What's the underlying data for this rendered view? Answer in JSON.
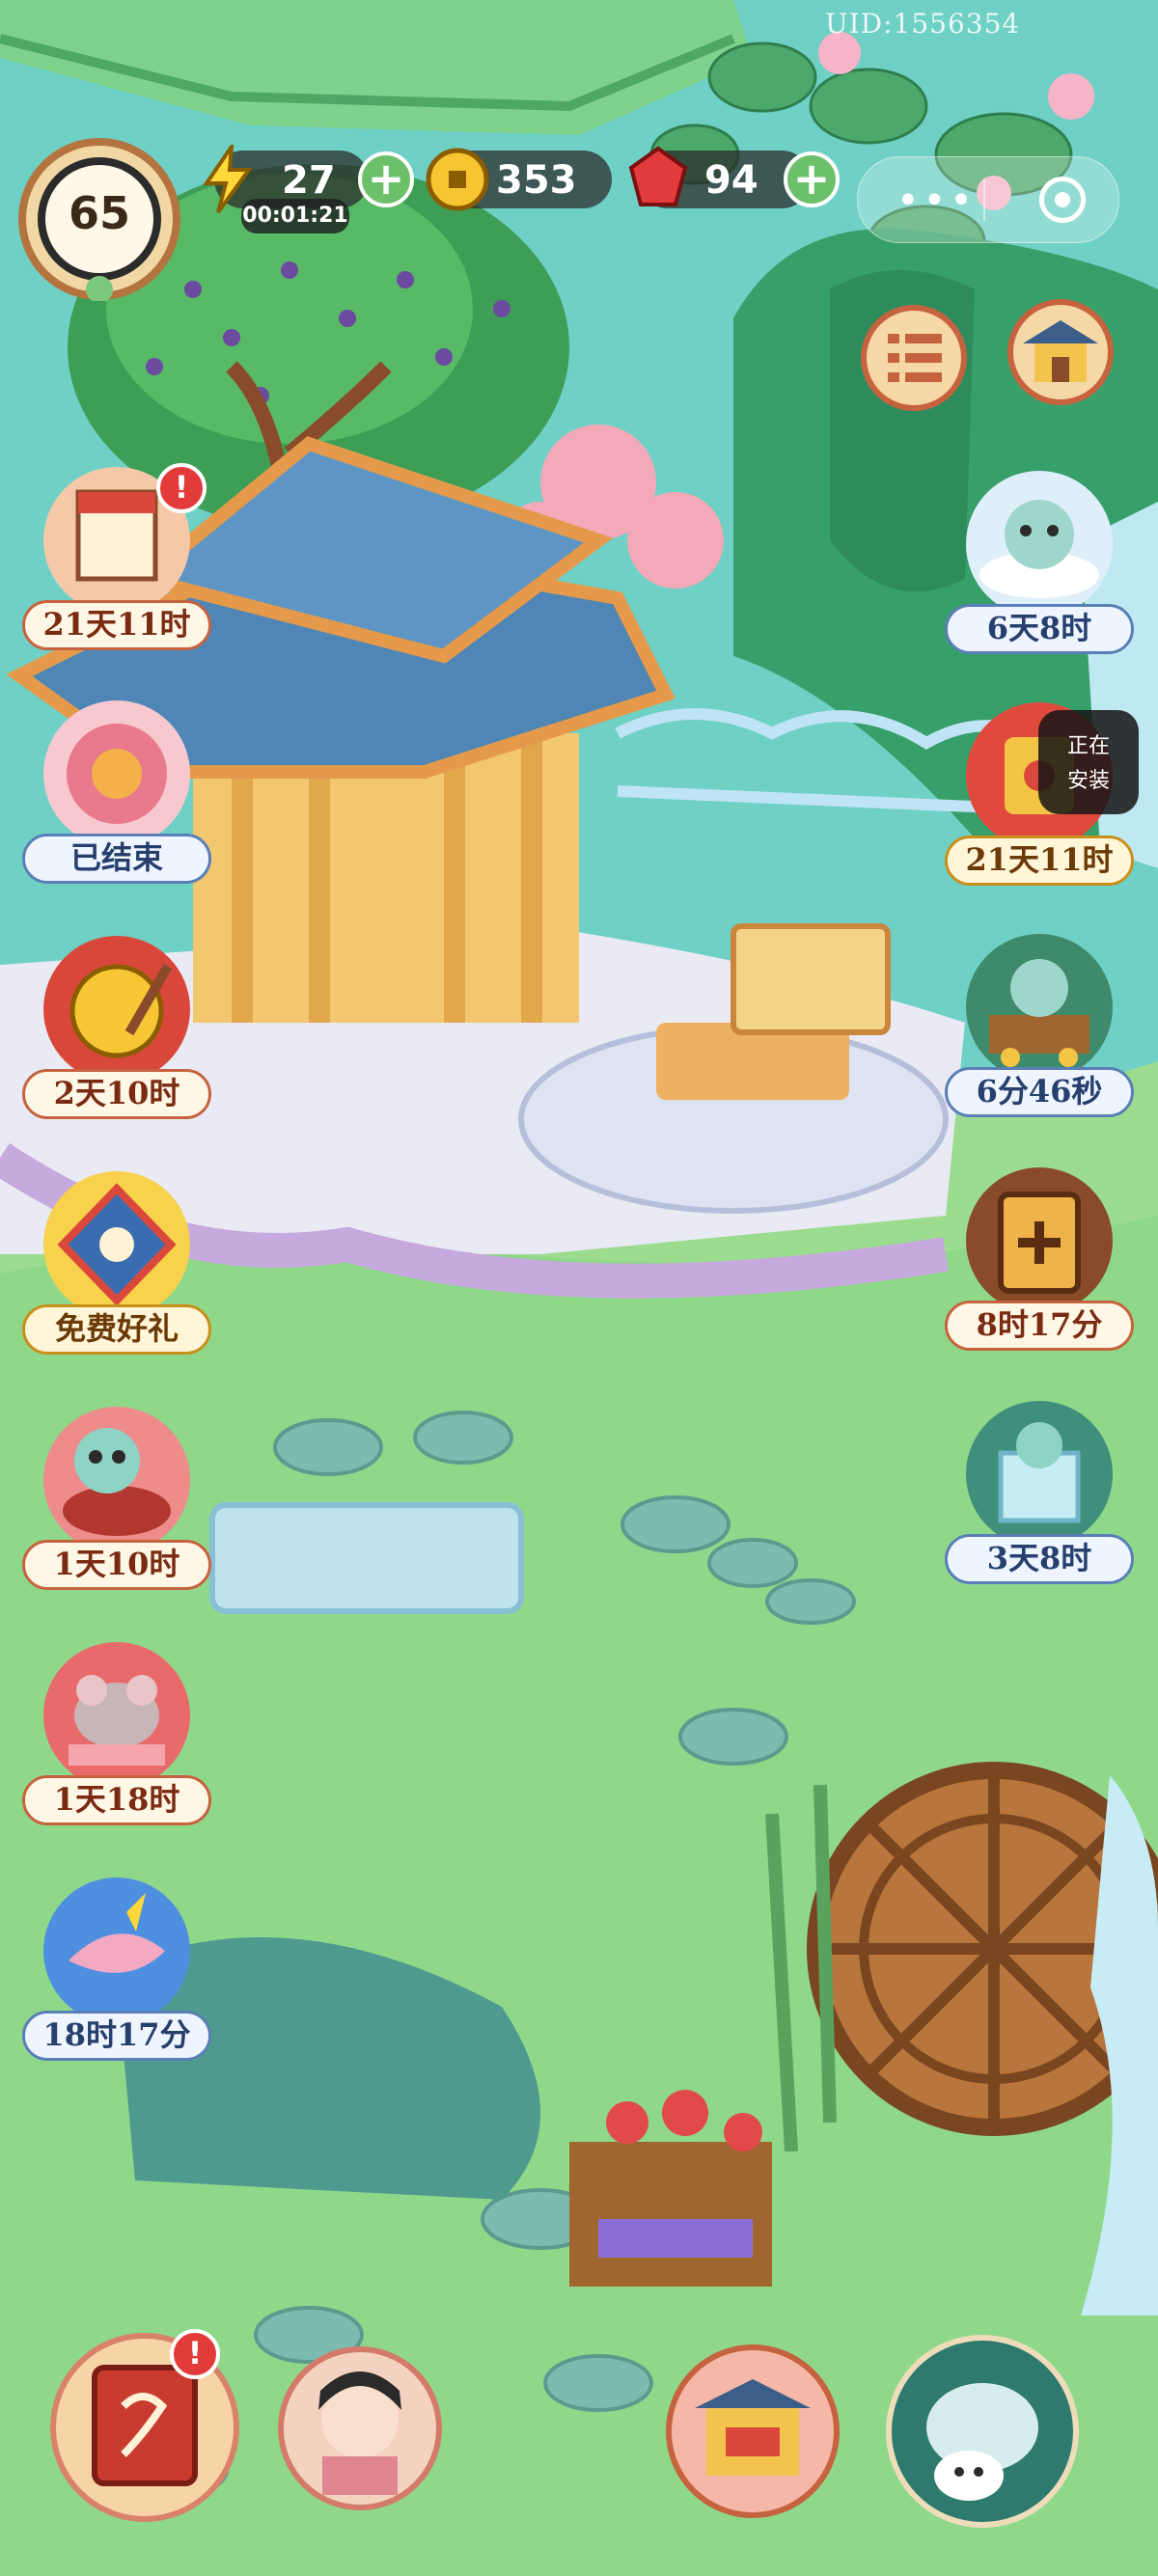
{
  "uid_text": "UID:1556354",
  "player": {
    "level": "65"
  },
  "resources": {
    "energy": {
      "icon": "lightning-icon",
      "value": "27",
      "timer": "00:01:21"
    },
    "coins": {
      "icon": "coin-icon",
      "value": "353"
    },
    "gems": {
      "icon": "red-gem-icon",
      "value": "94"
    },
    "plus_symbol": "+"
  },
  "system_menu": {
    "dots": "•••"
  },
  "status_overlay": {
    "line1": "正在",
    "line2": "安装"
  },
  "left_events": [
    {
      "id": "calendar-gift",
      "label": "21天11时",
      "alert": "!"
    },
    {
      "id": "peony-flower",
      "label": "已结束"
    },
    {
      "id": "golden-gong",
      "label": "2天10时"
    },
    {
      "id": "free-gift",
      "label": "免费好礼"
    },
    {
      "id": "cat-drum",
      "label": "1天10时"
    },
    {
      "id": "mouse-gift",
      "label": "1天18时"
    },
    {
      "id": "dragon-fish",
      "label": "18时17分"
    }
  ],
  "right_events": [
    {
      "id": "cloud-cat",
      "label": "6天8时"
    },
    {
      "id": "lucky-bag",
      "label": "21天11时"
    },
    {
      "id": "cat-cart",
      "label": "6分46秒"
    },
    {
      "id": "door-pass",
      "label": "8时17分"
    },
    {
      "id": "ice-cat-box",
      "label": "3天8时"
    }
  ],
  "bottom_bar": {
    "book_alert": "!"
  },
  "colors": {
    "grass": "#8fd88a",
    "water": "#74d0c8",
    "roof": "#4f86b6",
    "label_border": "#c6633f"
  }
}
